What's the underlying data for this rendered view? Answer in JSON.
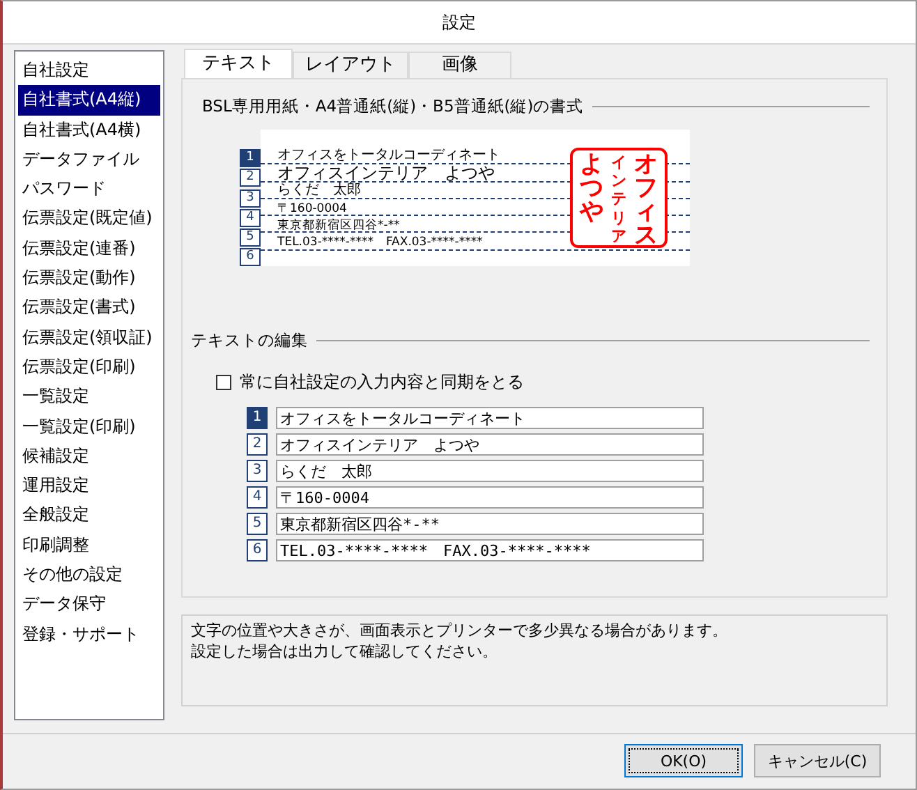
{
  "window": {
    "title": "設定"
  },
  "sidebar": {
    "items": [
      {
        "label": "自社設定",
        "selected": false
      },
      {
        "label": "自社書式(A4縦)",
        "selected": true
      },
      {
        "label": "自社書式(A4横)",
        "selected": false
      },
      {
        "label": "データファイル",
        "selected": false
      },
      {
        "label": "パスワード",
        "selected": false
      },
      {
        "label": "伝票設定(既定値)",
        "selected": false
      },
      {
        "label": "伝票設定(連番)",
        "selected": false
      },
      {
        "label": "伝票設定(動作)",
        "selected": false
      },
      {
        "label": "伝票設定(書式)",
        "selected": false
      },
      {
        "label": "伝票設定(領収証)",
        "selected": false
      },
      {
        "label": "伝票設定(印刷)",
        "selected": false
      },
      {
        "label": "一覧設定",
        "selected": false
      },
      {
        "label": "一覧設定(印刷)",
        "selected": false
      },
      {
        "label": "候補設定",
        "selected": false
      },
      {
        "label": "運用設定",
        "selected": false
      },
      {
        "label": "全般設定",
        "selected": false
      },
      {
        "label": "印刷調整",
        "selected": false
      },
      {
        "label": "その他の設定",
        "selected": false
      },
      {
        "label": "データ保守",
        "selected": false
      },
      {
        "label": "登録・サポート",
        "selected": false
      }
    ]
  },
  "tabs": [
    {
      "label": "テキスト",
      "selected": true
    },
    {
      "label": "レイアウト",
      "selected": false
    },
    {
      "label": "画像",
      "selected": false
    }
  ],
  "preview": {
    "title": "BSL専用用紙・A4普通紙(縦)・B5普通紙(縦)の書式",
    "lines": [
      {
        "number": "1",
        "text": "オフィスをトータルコーディネート",
        "kind": "normal",
        "selected": true
      },
      {
        "number": "2",
        "text": "オフィスインテリア　よつや",
        "kind": "large",
        "selected": false
      },
      {
        "number": "3",
        "text": "らくだ　太郎",
        "kind": "normal",
        "selected": false
      },
      {
        "number": "4",
        "text": "〒160-0004",
        "kind": "small",
        "selected": false
      },
      {
        "number": "5",
        "text": "東京都新宿区四谷*-**",
        "kind": "small",
        "selected": false
      },
      {
        "number": "6",
        "text": "TEL.03-****-****　FAX.03-****-****",
        "kind": "small",
        "selected": false
      }
    ],
    "stamp": {
      "columns": [
        "よつや",
        "インテリア",
        "オフィス"
      ]
    }
  },
  "editor": {
    "title": "テキストの編集",
    "sync": {
      "label": "常に自社設定の入力内容と同期をとる",
      "checked": false
    },
    "fields": [
      {
        "number": "1",
        "value": "オフィスをトータルコーディネート",
        "selected": true
      },
      {
        "number": "2",
        "value": "オフィスインテリア　よつや",
        "selected": false
      },
      {
        "number": "3",
        "value": "らくだ　太郎",
        "selected": false
      },
      {
        "number": "4",
        "value": "〒160-0004",
        "selected": false
      },
      {
        "number": "5",
        "value": "東京都新宿区四谷*-**",
        "selected": false
      },
      {
        "number": "6",
        "value": "TEL.03-****-****　FAX.03-****-****",
        "selected": false
      }
    ]
  },
  "notice": {
    "lines": [
      "文字の位置や大きさが、画面表示とプリンターで多少異なる場合があります。",
      "設定した場合は出力して確認してください。"
    ]
  },
  "buttons": [
    {
      "label": "OK(O)",
      "kind": "default"
    },
    {
      "label": "キャンセル(C)",
      "kind": "normal"
    }
  ]
}
